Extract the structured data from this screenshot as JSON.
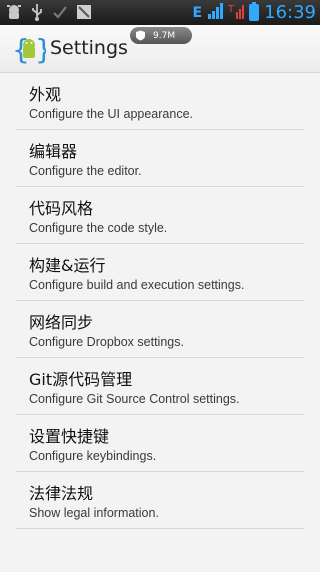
{
  "status_bar": {
    "icons": [
      "android-debug-icon",
      "usb-icon",
      "check-icon",
      "screenshot-icon"
    ],
    "network_type": "E",
    "clock": "16:39",
    "accent_color": "#32a8ff"
  },
  "action_bar": {
    "title": "Settings",
    "memory_badge": "9.7M",
    "icon": "android-app-icon"
  },
  "settings": [
    {
      "title": "外观",
      "summary": "Configure the UI appearance."
    },
    {
      "title": "编辑器",
      "summary": "Configure the editor."
    },
    {
      "title": "代码风格",
      "summary": "Configure the code style."
    },
    {
      "title": "构建&运行",
      "summary": "Configure build and execution settings."
    },
    {
      "title": "网络同步",
      "summary": "Configure Dropbox settings."
    },
    {
      "title": "Git源代码管理",
      "summary": "Configure Git Source Control settings."
    },
    {
      "title": "设置快捷键",
      "summary": "Configure keybindings."
    },
    {
      "title": "法律法规",
      "summary": "Show legal information."
    }
  ]
}
